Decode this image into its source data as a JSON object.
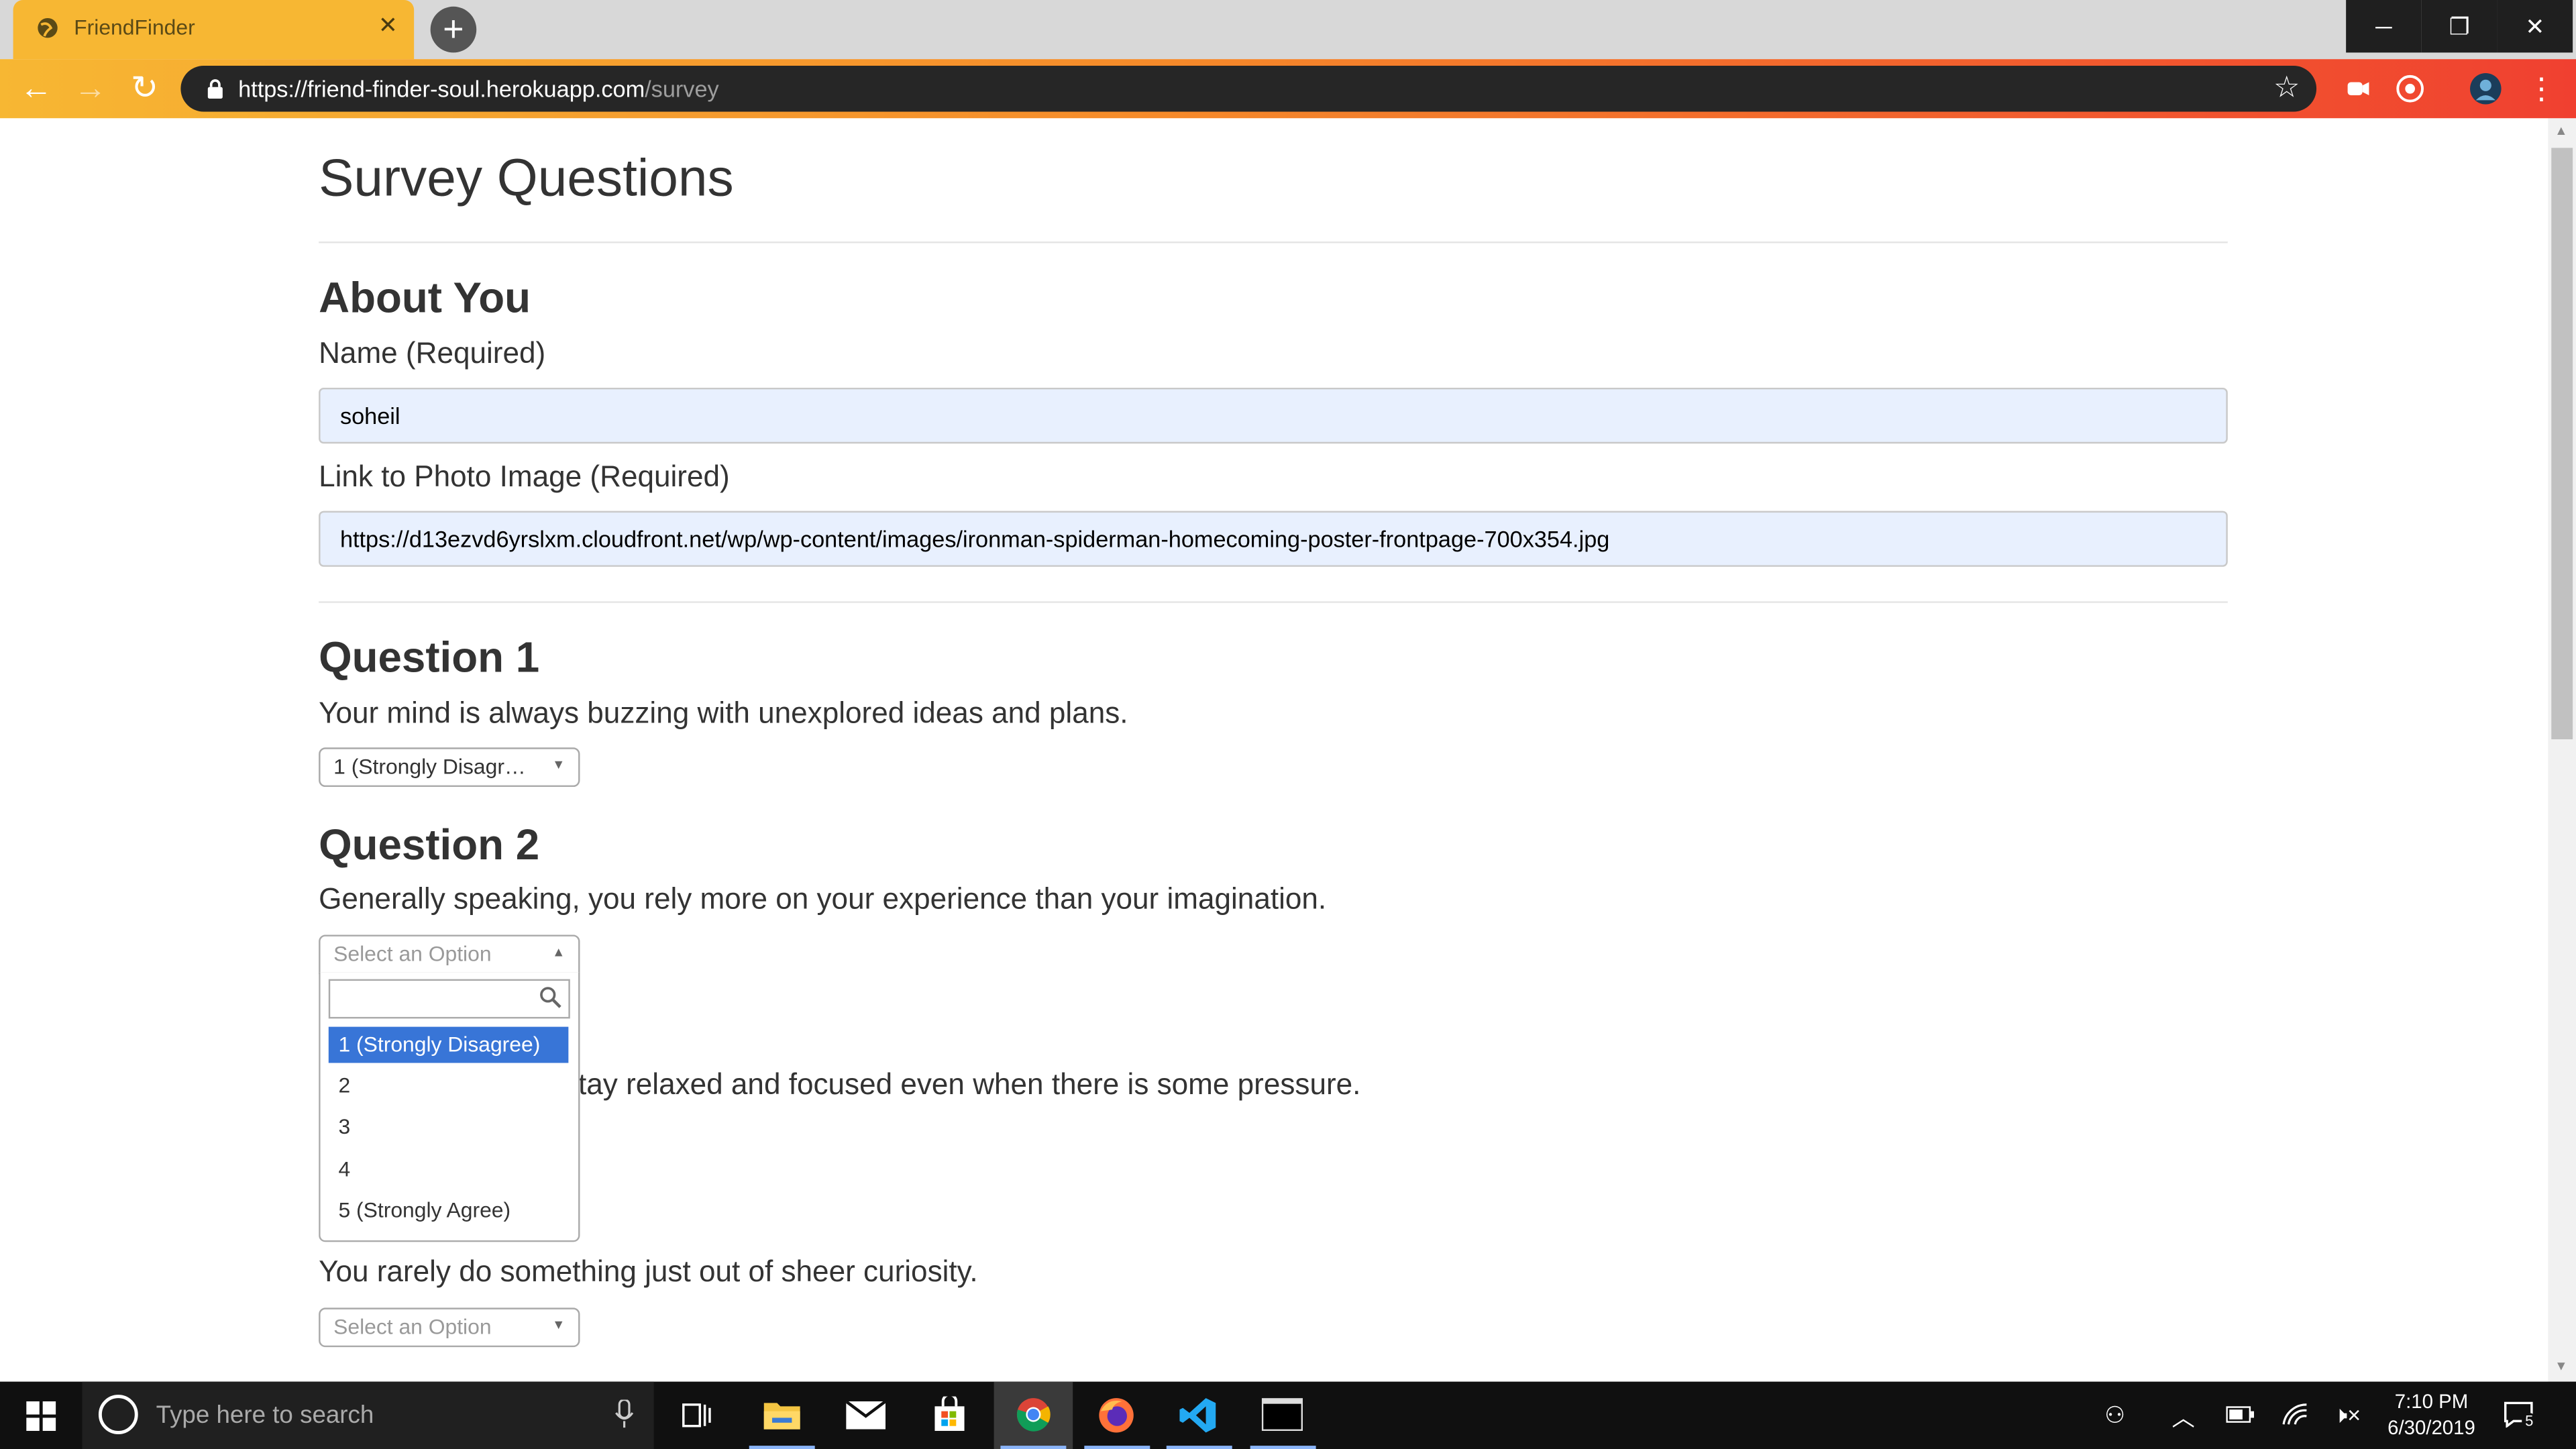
{
  "browser": {
    "tab_title": "FriendFinder",
    "tab_close": "✕",
    "new_tab": "+",
    "url_host": "https://friend-finder-soul.herokuapp.com",
    "url_path": "/survey",
    "window_controls": [
      "─",
      "❐",
      "✕"
    ]
  },
  "page": {
    "title": "Survey Questions",
    "about": {
      "heading": "About You",
      "name_label": "Name (Required)",
      "name_value": "soheil",
      "photo_label": "Link to Photo Image (Required)",
      "photo_value": "https://d13ezvd6yrslxm.cloudfront.net/wp/wp-content/images/ironman-spiderman-homecoming-poster-frontpage-700x354.jpg"
    },
    "questions": [
      {
        "heading": "Question 1",
        "text": "Your mind is always buzzing with unexplored ideas and plans.",
        "selected": "1 (Strongly Disagr…"
      },
      {
        "heading": "Question 2",
        "text": "Generally speaking, you rely more on your experience than your imagination.",
        "selected": "Select an Option"
      },
      {
        "text_visible": "tay relaxed and focused even when there is some pressure."
      },
      {
        "text": "You rarely do something just out of sheer curiosity.",
        "selected": "Select an Option"
      }
    ],
    "dropdown_options": [
      "1 (Strongly Disagree)",
      "2",
      "3",
      "4",
      "5 (Strongly Agree)"
    ],
    "dropdown_highlight_index": 0
  },
  "taskbar": {
    "search_placeholder": "Type here to search",
    "time": "7:10 PM",
    "date": "6/30/2019",
    "notification_count": "5",
    "apps": [
      "task-view-icon",
      "file-explorer-icon",
      "mail-icon",
      "store-icon",
      "chrome-icon",
      "firefox-icon",
      "vscode-icon",
      "terminal-icon"
    ]
  },
  "colors": {
    "theme_start": "#f7b733",
    "theme_end": "#f04030",
    "highlight": "#3875d7",
    "autofill_bg": "#e8f0fe"
  }
}
